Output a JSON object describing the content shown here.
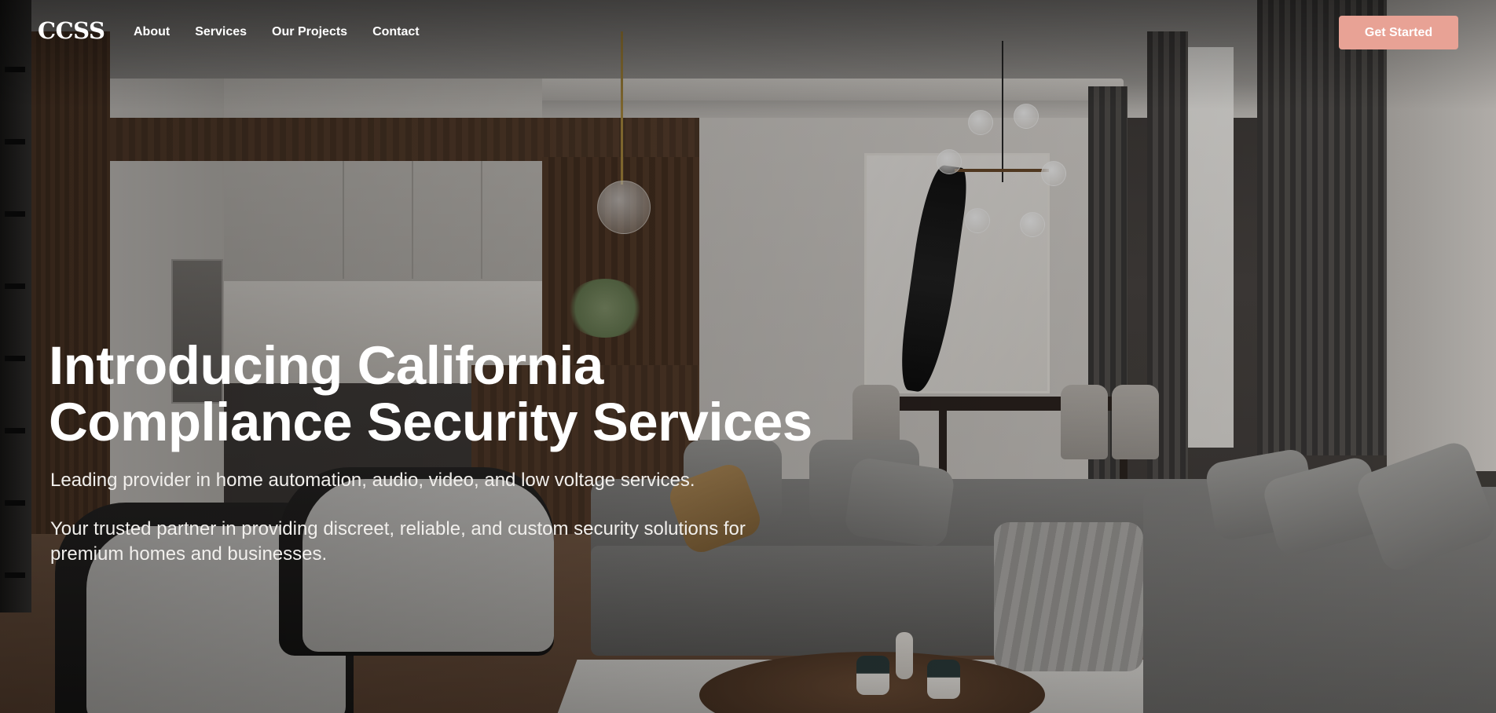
{
  "header": {
    "logo": "CCSS",
    "nav": [
      {
        "label": "About"
      },
      {
        "label": "Services"
      },
      {
        "label": "Our Projects"
      },
      {
        "label": "Contact"
      }
    ],
    "cta_label": "Get Started"
  },
  "hero": {
    "title_line1": "Introducing California",
    "title_line2": "Compliance Security Services",
    "subtitle": "Leading provider in home automation, audio, video, and low voltage services.",
    "description": "Your trusted partner in providing discreet, reliable, and custom security solutions for premium homes and businesses."
  },
  "colors": {
    "accent": "#e8a295",
    "text": "#ffffff"
  }
}
